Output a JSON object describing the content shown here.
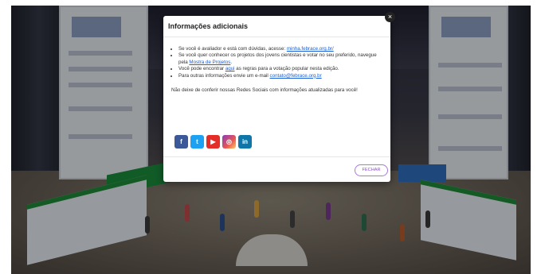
{
  "modal": {
    "title": "Informações adicionais",
    "items": [
      {
        "before": "Se você é avaliador e está com dúvidas, acesse: ",
        "link": "minha.febrace.org.br/",
        "after": ""
      },
      {
        "before": "Se você quer conhecer os projetos dos jovens cientistas e votar no seu preferido, navegue pela ",
        "link": "Mostra de Projetos",
        "after": "."
      },
      {
        "before": "Você pode encontrar ",
        "link": "aqui",
        "after": " as regras para a votação popular nesta edição."
      },
      {
        "before": "Para outras informações envie um e-mail ",
        "link": "contato@febrace.org.br",
        "after": ""
      }
    ],
    "notice": "Não deixe de conferir nossas Redes Sociais com informações atualizadas para você!",
    "close_label": "FECHAR",
    "close_icon": "×"
  },
  "socials": [
    {
      "name": "facebook-icon",
      "glyph": "f"
    },
    {
      "name": "twitter-icon",
      "glyph": "t"
    },
    {
      "name": "youtube-icon",
      "glyph": "▶"
    },
    {
      "name": "instagram-icon",
      "glyph": "◎"
    },
    {
      "name": "linkedin-icon",
      "glyph": "in"
    }
  ],
  "colors": {
    "link": "#1a5fd6",
    "close_button_border": "#a77ad8",
    "facebook": "#3b5998",
    "twitter": "#1da1f2",
    "youtube": "#e52d27",
    "linkedin": "#0e76a8"
  }
}
